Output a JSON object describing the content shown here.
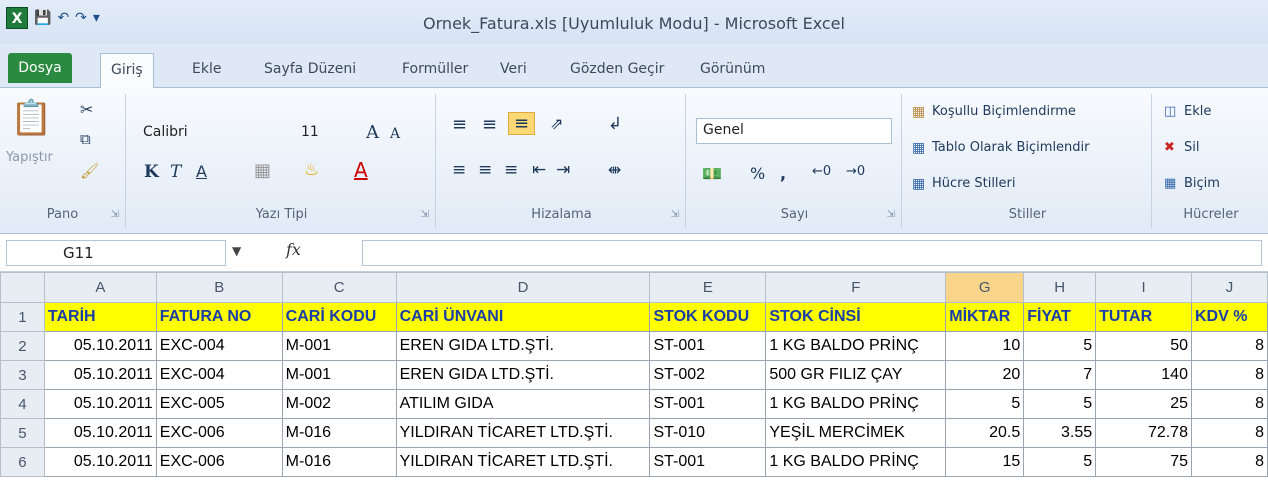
{
  "window": {
    "title": "Ornek_Fatura.xls  [Uyumluluk Modu]  -  Microsoft Excel",
    "app_icon": "X"
  },
  "tabs": [
    "Dosya",
    "Giriş",
    "Ekle",
    "Sayfa Düzeni",
    "Formüller",
    "Veri",
    "Gözden Geçir",
    "Görünüm"
  ],
  "ribbon": {
    "clipboard": {
      "paste": "Yapıştır",
      "group": "Pano"
    },
    "font": {
      "name": "Calibri",
      "size": "11",
      "bold": "K",
      "italic": "T",
      "underline": "A",
      "group": "Yazı Tipi"
    },
    "alignment": {
      "group": "Hizalama"
    },
    "number": {
      "format": "Genel",
      "percent": "%",
      "comma": ",",
      "group": "Sayı"
    },
    "styles": {
      "conditional": "Koşullu Biçimlendirme",
      "table": "Tablo Olarak Biçimlendir",
      "cell": "Hücre Stilleri",
      "group": "Stiller"
    },
    "cells": {
      "insert": "Ekle",
      "delete": "Sil",
      "format": "Biçim",
      "group": "Hücreler"
    }
  },
  "formula_bar": {
    "name_box": "G11",
    "fx": "fx",
    "value": ""
  },
  "columns": [
    "A",
    "B",
    "C",
    "D",
    "E",
    "F",
    "G",
    "H",
    "I",
    "J"
  ],
  "selected_column": "G",
  "header_row": [
    "TARİH",
    "FATURA NO",
    "CARİ KODU",
    "CARİ ÜNVANI",
    "STOK KODU",
    "STOK CİNSİ",
    "MİKTAR",
    "FİYAT",
    "TUTAR",
    "KDV %"
  ],
  "rows": [
    [
      "05.10.2011",
      "EXC-004",
      "M-001",
      "EREN GIDA LTD.ŞTİ.",
      "ST-001",
      "1 KG BALDO PRİNÇ",
      "10",
      "5",
      "50",
      "8"
    ],
    [
      "05.10.2011",
      "EXC-004",
      "M-001",
      "EREN GIDA LTD.ŞTİ.",
      "ST-002",
      "500 GR FILIZ ÇAY",
      "20",
      "7",
      "140",
      "8"
    ],
    [
      "05.10.2011",
      "EXC-005",
      "M-002",
      "ATILIM GIDA",
      "ST-001",
      "1 KG BALDO PRİNÇ",
      "5",
      "5",
      "25",
      "8"
    ],
    [
      "05.10.2011",
      "EXC-006",
      "M-016",
      "YILDIRAN TİCARET LTD.ŞTİ.",
      "ST-010",
      "YEŞİL MERCİMEK",
      "20.5",
      "3.55",
      "72.78",
      "8"
    ],
    [
      "05.10.2011",
      "EXC-006",
      "M-016",
      "YILDIRAN TİCARET LTD.ŞTİ.",
      "ST-001",
      "1 KG BALDO PRİNÇ",
      "15",
      "5",
      "75",
      "8"
    ]
  ]
}
